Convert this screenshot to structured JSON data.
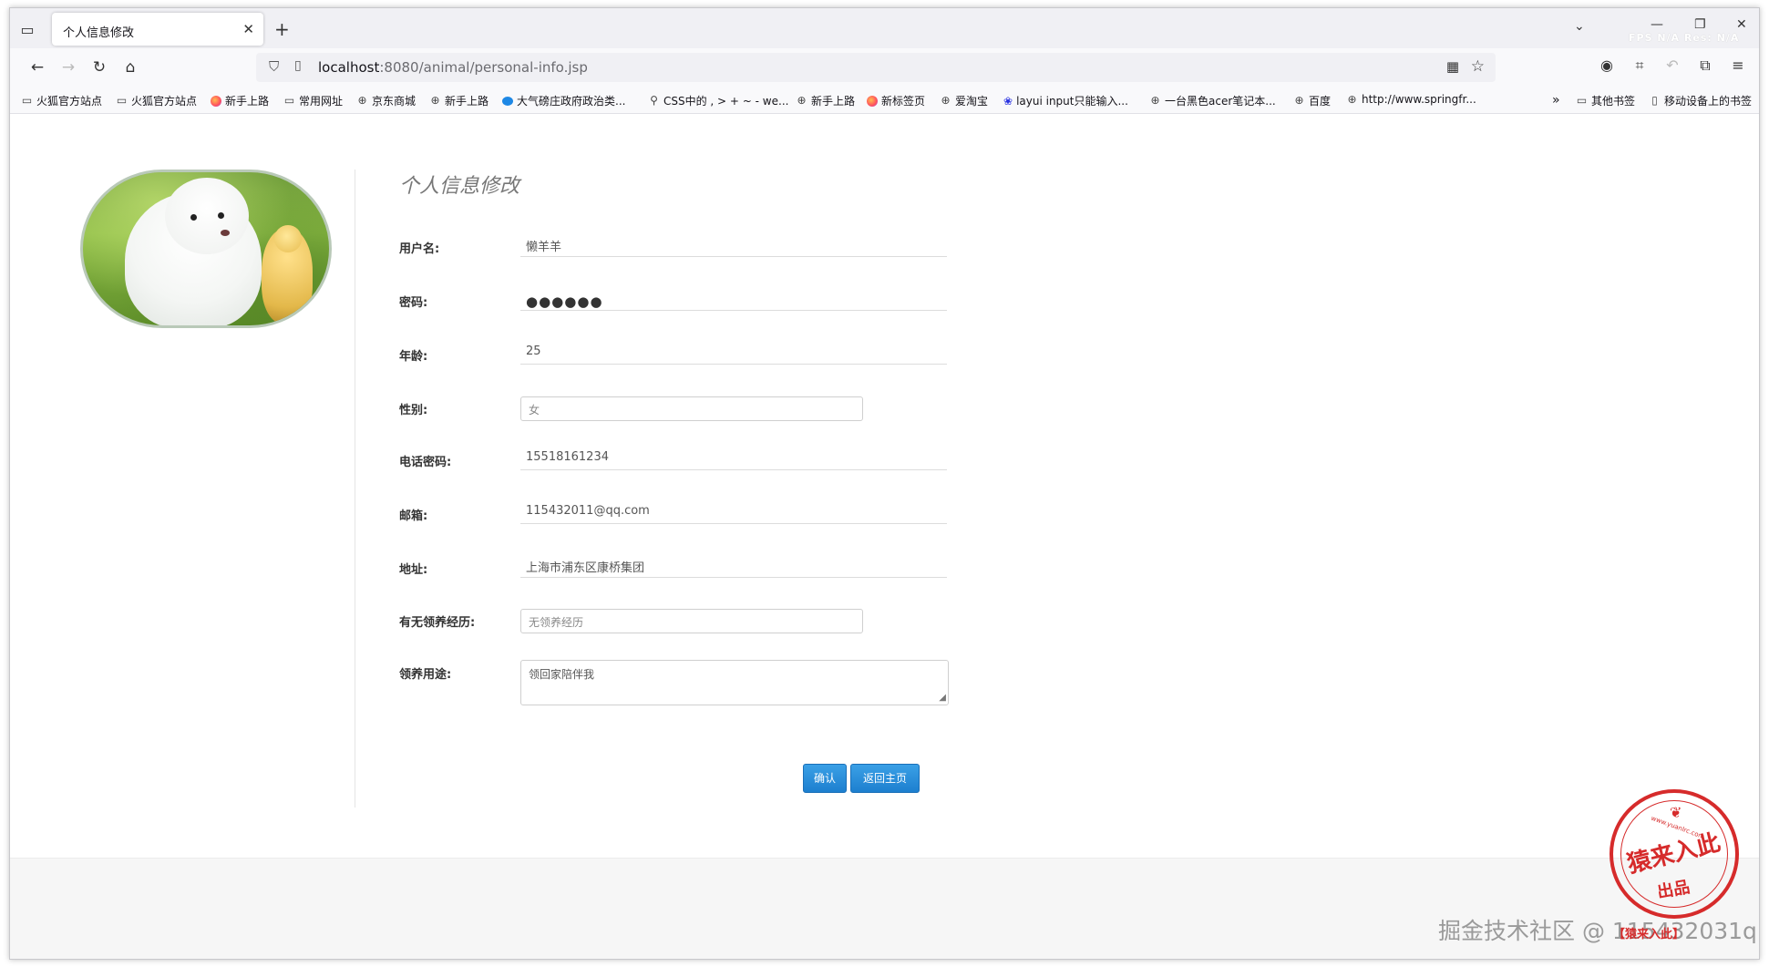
{
  "browser": {
    "tab_title": "个人信息修改",
    "tab_close": "✕",
    "new_tab": "+",
    "url_host": "localhost",
    "url_path": ":8080/animal/personal-info.jsp",
    "fps_overlay": "FPS N/A Res: N/A"
  },
  "bookmarks": [
    {
      "label": "火狐官方站点",
      "icon": "folder-icon"
    },
    {
      "label": "火狐官方站点",
      "icon": "folder-icon"
    },
    {
      "label": "新手上路",
      "icon": "firefox-icon"
    },
    {
      "label": "常用网址",
      "icon": "folder-icon"
    },
    {
      "label": "京东商城",
      "icon": "globe-icon"
    },
    {
      "label": "新手上路",
      "icon": "globe-icon"
    },
    {
      "label": "大气磅庄政府政治类...",
      "icon": "site-icon"
    },
    {
      "label": "CSS中的 , > + ~ - we...",
      "icon": "link-icon"
    },
    {
      "label": "新手上路",
      "icon": "globe-icon"
    },
    {
      "label": "新标签页",
      "icon": "firefox-icon"
    },
    {
      "label": "爱淘宝",
      "icon": "globe-icon"
    },
    {
      "label": "layui input只能输入...",
      "icon": "paw-icon"
    },
    {
      "label": "一台黑色acer笔记本...",
      "icon": "globe-icon"
    },
    {
      "label": "百度",
      "icon": "globe-icon"
    },
    {
      "label": "http://www.springfr...",
      "icon": "globe-icon"
    }
  ],
  "bookmarks_right": {
    "overflow": "»",
    "other": "其他书签",
    "mobile": "移动设备上的书签"
  },
  "form": {
    "title": "个人信息修改",
    "labels": {
      "username": "用户名:",
      "password": "密码:",
      "age": "年龄:",
      "gender": "性别:",
      "phone": "电话密码:",
      "email": "邮箱:",
      "address": "地址:",
      "experience": "有无领养经历:",
      "purpose": "领养用途:"
    },
    "values": {
      "username": "懒羊羊",
      "password_dots": "●●●●●●",
      "age": "25",
      "gender": "女",
      "phone": "15518161234",
      "email": "115432011@qq.com",
      "address": "上海市浦东区康桥集团",
      "experience_placeholder": "无领养经历",
      "purpose": "领回家陪伴我"
    },
    "buttons": {
      "confirm": "确认",
      "back": "返回主页"
    }
  },
  "watermark": {
    "text": "掘金技术社区 @ 115432031q",
    "seal_line1": "猿来入此",
    "seal_line2": "出品",
    "seal_url": "www.yuanlrc.com",
    "seal_bottom": "【猿来入此】"
  }
}
